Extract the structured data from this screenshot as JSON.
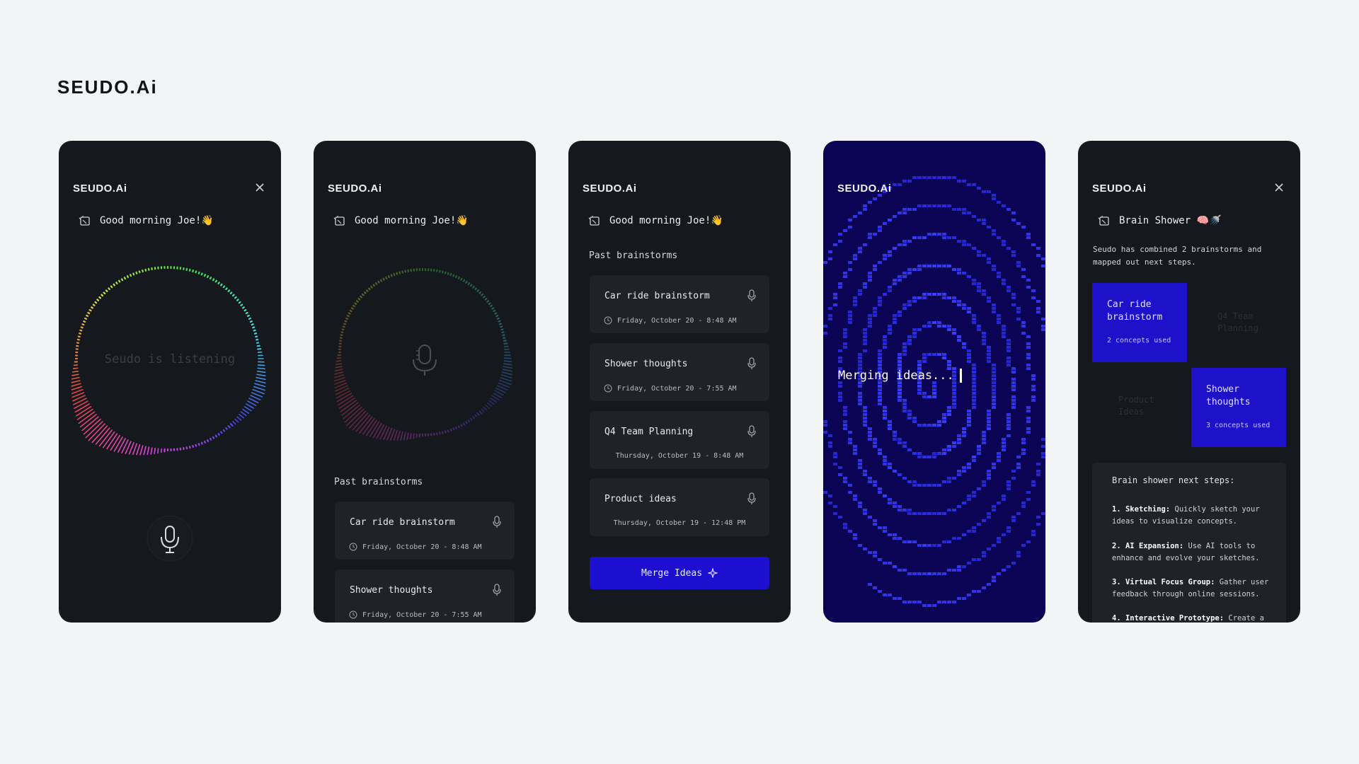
{
  "brand": "SEUDO.Ai",
  "logo": "SEUDO.Ai",
  "greeting": "Good morning Joe!👋",
  "icons": {
    "close": "close-icon",
    "mic": "microphone-icon",
    "clock": "clock-icon",
    "greet": "notebook-icon",
    "sparkle": "sparkle-icon"
  },
  "screen1": {
    "listening": "Seudo is listening"
  },
  "screen2": {
    "past_label": "Past brainstorms",
    "items": [
      {
        "title": "Car ride brainstorm",
        "date": "Friday, October 20 - 8:48 AM"
      },
      {
        "title": "Shower thoughts",
        "date": "Friday, October 20 - 7:55 AM"
      }
    ]
  },
  "screen3": {
    "past_label": "Past brainstorms",
    "items": [
      {
        "title": "Car ride brainstorm",
        "date": "Friday, October 20 - 8:48 AM"
      },
      {
        "title": "Shower thoughts",
        "date": "Friday, October 20 - 7:55 AM"
      },
      {
        "title": "Q4 Team Planning",
        "date": "Thursday, October 19 - 8:48 AM"
      },
      {
        "title": "Product ideas",
        "date": "Thursday, October 19 - 12:48 PM"
      }
    ],
    "merge_button": "Merge Ideas"
  },
  "screen4": {
    "merging": "Merging ideas..."
  },
  "screen5": {
    "title": "Brain Shower 🧠🚿",
    "description": "Seudo has combined 2 brainstorms and mapped out next steps.",
    "blocks": [
      {
        "title": "Car ride brainstorm",
        "sub": "2 concepts used"
      },
      {
        "title": "Shower thoughts",
        "sub": "3 concepts used"
      }
    ],
    "ghost_blocks": [
      "Q4 Team Planning",
      "Product Ideas"
    ],
    "next_steps_label": "Brain shower next steps:",
    "steps": [
      {
        "num": "1.",
        "name": "Sketching:",
        "text": "Quickly sketch your ideas to visualize concepts."
      },
      {
        "num": "2.",
        "name": "AI Expansion:",
        "text": "Use AI tools to enhance and evolve your sketches."
      },
      {
        "num": "3.",
        "name": "Virtual Focus Group:",
        "text": "Gather user feedback through online sessions."
      },
      {
        "num": "4.",
        "name": "Interactive Prototype:",
        "text": "Create a"
      }
    ]
  }
}
